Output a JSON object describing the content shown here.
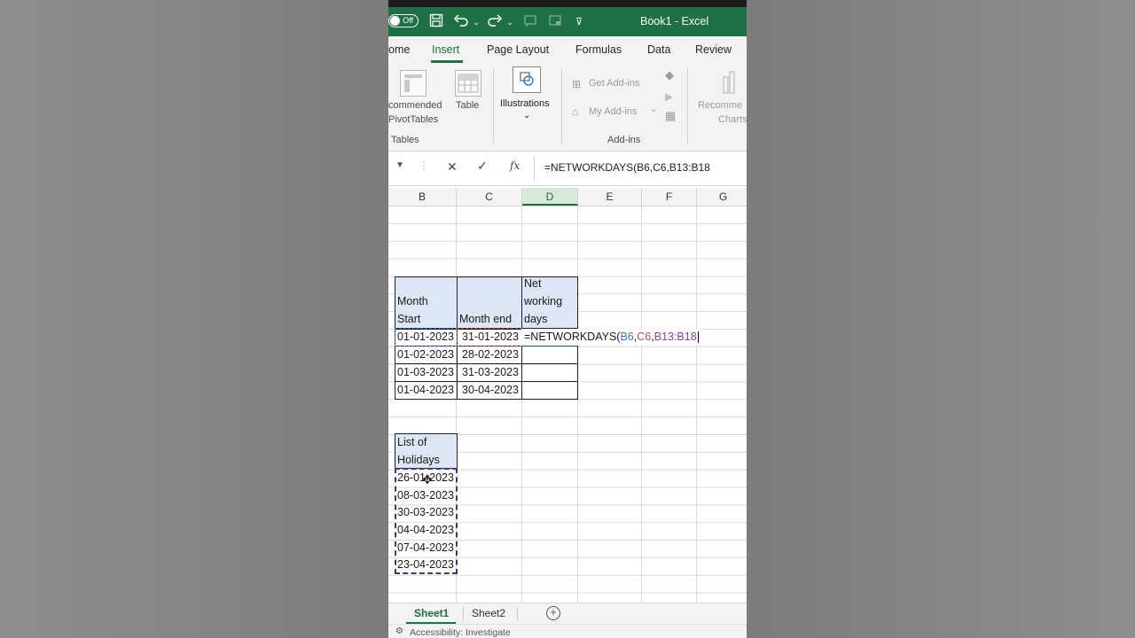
{
  "app": {
    "toggle": "Off",
    "title": "Book1 - Excel"
  },
  "tabs": [
    "ome",
    "Insert",
    "Page Layout",
    "Formulas",
    "Data",
    "Review"
  ],
  "ribbon": {
    "rec_pivot_l1": "commended",
    "rec_pivot_l2": "PivotTables",
    "table": "Table",
    "group_tables": "Tables",
    "illustrations": "Illustrations",
    "get_addins": "Get Add-ins",
    "my_addins": "My Add-ins",
    "group_addins": "Add-ins",
    "rec_charts_l1": "Recomme",
    "rec_charts_l2": "Charts"
  },
  "formula_bar": {
    "fx": "fx",
    "formula": "=NETWORKDAYS(B6,C6,B13:B18"
  },
  "columns": [
    "B",
    "C",
    "D",
    "E",
    "F",
    "G"
  ],
  "selected_column": "D",
  "table1": {
    "h_b_l1": "Month",
    "h_b_l2": "Start",
    "h_c": "Month end",
    "h_d_l1": "Net",
    "h_d_l2": "working",
    "h_d_l3": "days",
    "rows": [
      [
        "01-01-2023",
        "31-01-2023"
      ],
      [
        "01-02-2023",
        "28-02-2023"
      ],
      [
        "01-03-2023",
        "31-03-2023"
      ],
      [
        "01-04-2023",
        "30-04-2023"
      ]
    ],
    "edit_prefix": "=NETWORKDAYS(",
    "edit_ref1": "B6",
    "edit_sep1": ",",
    "edit_ref2": "C6",
    "edit_sep2": ",",
    "edit_ref3": "B13:B18"
  },
  "holidays": {
    "h_l1": "List of",
    "h_l2": "Holidays",
    "dates": [
      "26-01-2023",
      "08-03-2023",
      "30-03-2023",
      "04-04-2023",
      "07-04-2023",
      "23-04-2023"
    ]
  },
  "colors": {
    "ref1": "#4472c4",
    "ref2": "#c0504d",
    "ref3": "#8a3ca8",
    "excel_green": "#1e7145"
  },
  "sheets": [
    "Sheet1",
    "Sheet2"
  ],
  "active_sheet": "Sheet1",
  "status": "Accessibility: Investigate"
}
